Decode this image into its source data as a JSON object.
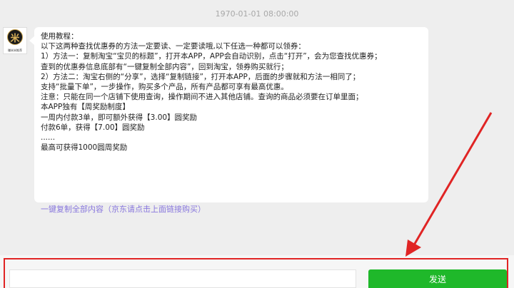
{
  "chat": {
    "timestamp": "1970-01-01 08:00:00",
    "avatar": {
      "glyph": "米",
      "caption": "赚米米推荐"
    },
    "message": {
      "lines": [
        "使用教程：",
        "以下这两种查找优惠券的方法一定要读、一定要读哦,以下任选一种都可以领券：",
        "1）方法一：复制淘宝“宝贝的标题”，打开本APP，APP会自动识别，点击“打开”，会为您查找优惠券；",
        "查到的优惠券信息底部有“一键复制全部内容”，回到淘宝，领券购买就行；",
        "2）方法二：淘宝右侧的“分享”，选择“复制链接”，打开本APP，后面的步骤就和方法一相同了；",
        "支持“批量下单”，一步操作，购买多个产品，所有产品都可享有最高优惠。",
        "注意：只能在同一个店铺下使用查询，操作期间不进入其他店铺。查询的商品必须要在订单里面；",
        "本APP独有【周奖励制度】",
        "一周内付款3单，即可额外获得【3.00】圆奖励",
        "付款6单，获得【7.00】圆奖励",
        "......",
        "最高可获得1000圆周奖励"
      ],
      "copy_link": "一键复制全部内容（京东请点击上面链接购买）"
    }
  },
  "composer": {
    "input_value": "",
    "send_label": "发送"
  },
  "colors": {
    "background": "#eeeeee",
    "send_button": "#1fb82a",
    "annotation": "#e02424",
    "link": "#8877dd"
  }
}
